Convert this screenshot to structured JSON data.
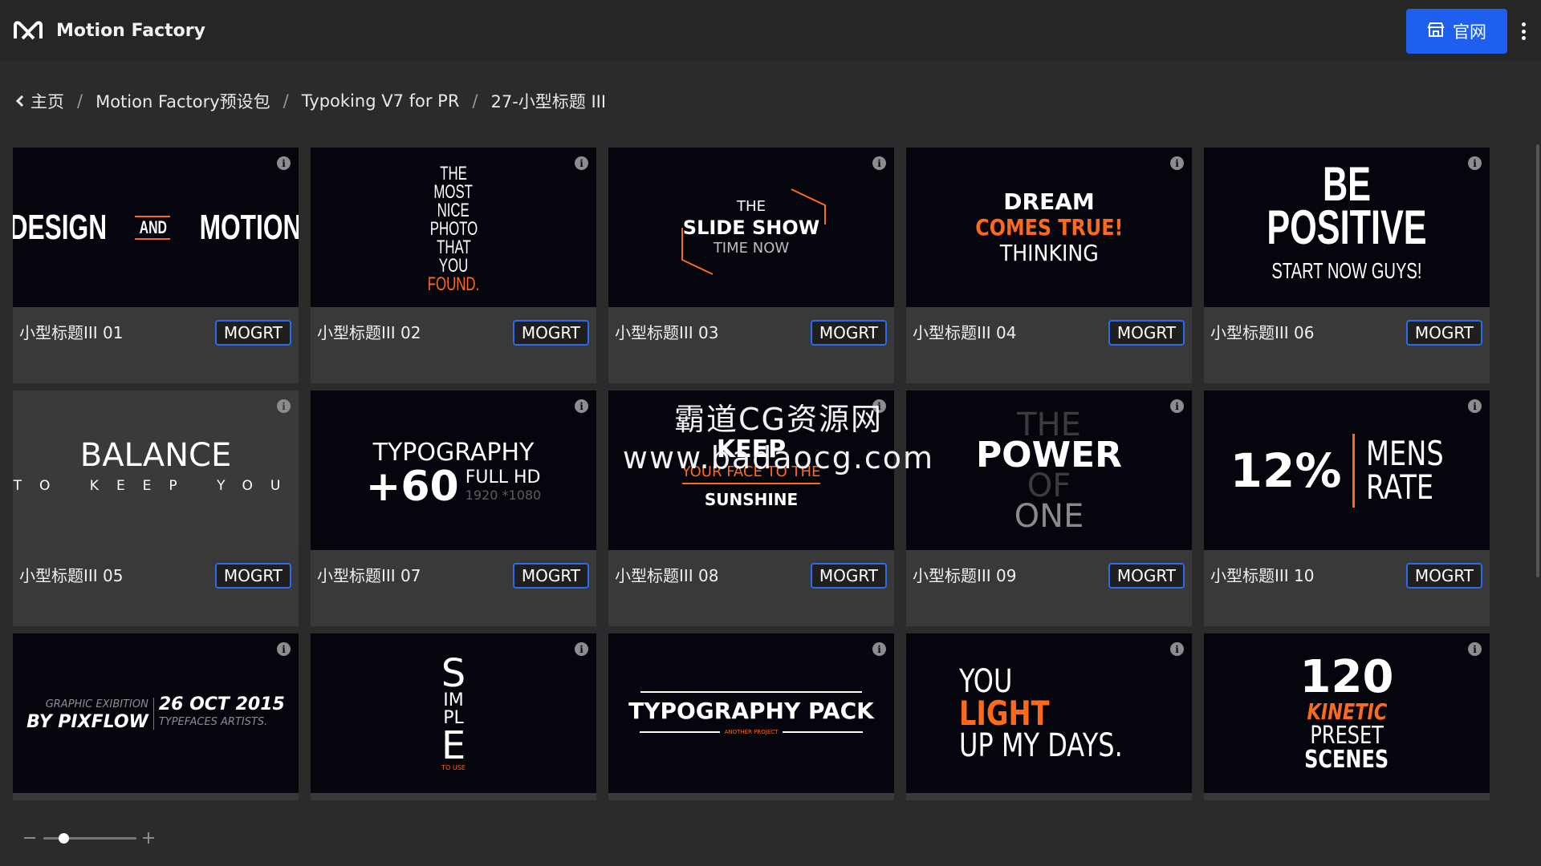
{
  "app": {
    "title": "Motion Factory",
    "logo_icon": "motion-factory-logo-icon"
  },
  "header": {
    "official_button": {
      "label": "官网",
      "icon": "store-icon"
    },
    "menu_icon": "more-vertical-icon"
  },
  "breadcrumb": {
    "back_icon": "chevron-left-icon",
    "items": [
      "主页",
      "Motion Factory预设包",
      "Typoking V7 for PR",
      "27-小型标题 III"
    ],
    "separator": "/"
  },
  "tag_label": "MOGRT",
  "info_icon": "info-icon",
  "cards": [
    {
      "title": "小型标题III 01",
      "art": [
        "DESIGN",
        "AND",
        "MOTION"
      ]
    },
    {
      "title": "小型标题III 02",
      "art": [
        "THE",
        "MOST",
        "NICE",
        "PHOTO",
        "THAT",
        "YOU",
        "FOUND."
      ]
    },
    {
      "title": "小型标题III 03",
      "art": [
        "THE",
        "SLIDE SHOW",
        "TIME NOW"
      ]
    },
    {
      "title": "小型标题III 04",
      "art": [
        "DREAM",
        "COMES TRUE!",
        "THINKING"
      ]
    },
    {
      "title": "小型标题III 06",
      "art": [
        "BE POSITIVE",
        "START NOW GUYS!"
      ]
    },
    {
      "title": "小型标题III 05",
      "art": [
        "BALANCE",
        "TO KEEP YOU"
      ]
    },
    {
      "title": "小型标题III 07",
      "art": [
        "TYPOGRAPHY",
        "+60",
        "FULL HD",
        "1920 *1080"
      ]
    },
    {
      "title": "小型标题III 08",
      "art": [
        "KEEP",
        "YOUR FACE TO THE",
        "SUNSHINE"
      ]
    },
    {
      "title": "小型标题III 09",
      "art": [
        "THE",
        "POWER",
        "OF",
        "ONE"
      ]
    },
    {
      "title": "小型标题III 10",
      "art": [
        "12%",
        "MENS",
        "RATE"
      ]
    },
    {
      "title": "",
      "art": [
        "GRAPHIC EXIBITION",
        "BY PIXFLOW",
        "26 OCT 2015",
        "TYPEFACES ARTISTS."
      ]
    },
    {
      "title": "",
      "art": [
        "S",
        "IM",
        "PL",
        "E",
        "TO USE"
      ]
    },
    {
      "title": "",
      "art": [
        "TYPOGRAPHY PACK",
        "ANOTHER PROJECT"
      ]
    },
    {
      "title": "",
      "art": [
        "YOU",
        "LIGHT",
        "UP MY DAYS."
      ]
    },
    {
      "title": "",
      "art": [
        "120",
        "KINETIC",
        "PRESET",
        "SCENES"
      ]
    }
  ],
  "watermark": {
    "line1": "霸道CG资源网",
    "line2": "www.badaocg.com"
  },
  "zoom": {
    "minus_icon": "minus-icon",
    "plus_icon": "plus-icon",
    "level": 0.2
  },
  "colors": {
    "accent": "#1e5ff0",
    "orange": "#ff6a1a",
    "card_bg": "#393939",
    "thumb_bg": "#05050e"
  }
}
